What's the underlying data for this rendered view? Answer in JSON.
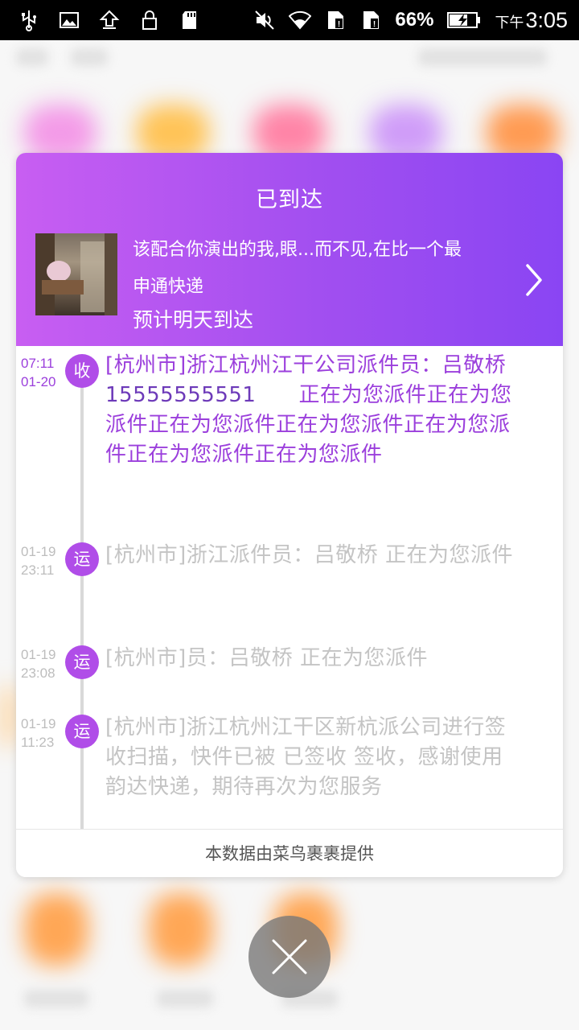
{
  "status_bar": {
    "battery": "66%",
    "time_prefix": "下午",
    "time": "3:05"
  },
  "package": {
    "status_title": "已到达",
    "product_name": "该配合你演出的我,眼...而不见,在比一个最",
    "courier": "申通快递",
    "eta": "预计明天到达"
  },
  "timeline": [
    {
      "badge": "收",
      "date": "07:11",
      "time": "01-20",
      "text_before": "[杭州市]浙江杭州江干公司派件员：吕敬桥",
      "phone": "15555555551",
      "text_after": "　　正在为您派件正在为您派件正在为您派件正在为您派件正在为您派件正在为您派件正在为您派件"
    },
    {
      "badge": "运",
      "date": "01-19",
      "time": "23:11",
      "text": "[杭州市]浙江派件员：吕敬桥  正在为您派件"
    },
    {
      "badge": "运",
      "date": "01-19",
      "time": "23:08",
      "text": "[杭州市]员：吕敬桥  正在为您派件"
    },
    {
      "badge": "运",
      "date": "01-19",
      "time": "11:23",
      "text": "[杭州市]浙江杭州江干区新杭派公司进行签收扫描，快件已被 已签收  签收，感谢使用韵达快递，期待再次为您服务"
    }
  ],
  "footer": "本数据由菜鸟裹裹提供",
  "colors": {
    "accent": "#9b3fdc",
    "header_gradient_start": "#c85ef2",
    "header_gradient_end": "#8a45f3",
    "badge": "#b04de8",
    "muted_text": "#c4c4c4"
  },
  "icons": [
    "usb-icon",
    "image-icon",
    "upload-icon",
    "lock-icon",
    "sd-card-icon",
    "mute-icon",
    "wifi-icon",
    "sim-icon",
    "battery-icon",
    "chevron-right-icon",
    "close-icon"
  ]
}
